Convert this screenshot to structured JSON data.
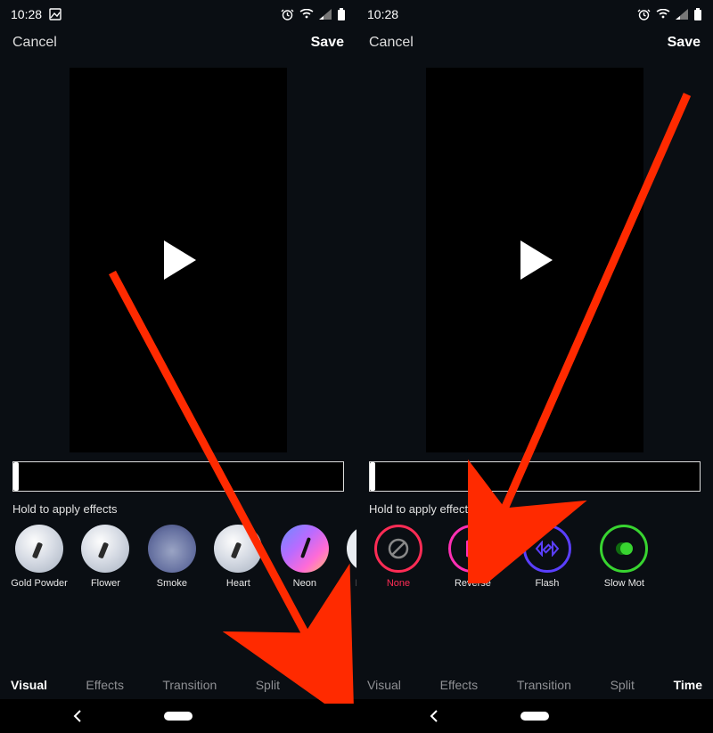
{
  "status": {
    "time": "10:28",
    "icons": [
      "picture",
      "alarm",
      "wifi",
      "signal",
      "battery"
    ]
  },
  "topbar": {
    "cancel": "Cancel",
    "save": "Save"
  },
  "hint": "Hold to apply effects",
  "visual_effects": [
    {
      "label": "Gold Powder"
    },
    {
      "label": "Flower"
    },
    {
      "label": "Smoke"
    },
    {
      "label": "Heart"
    },
    {
      "label": "Neon"
    },
    {
      "label": "Rainbo"
    }
  ],
  "time_effects": [
    {
      "label": "None",
      "color": "#fe2c55",
      "icon": "none"
    },
    {
      "label": "Reverse",
      "color": "#ff2fb3",
      "icon": "reverse"
    },
    {
      "label": "Flash",
      "color": "#5a3fff",
      "icon": "flash"
    },
    {
      "label": "Slow Mot",
      "color": "#38d430",
      "icon": "slowmo"
    }
  ],
  "tabs": [
    "Visual",
    "Effects",
    "Transition",
    "Split",
    "Time"
  ],
  "active_tab_left": "Visual",
  "active_tab_right": "Time",
  "arrows": {
    "color": "#ff2a00"
  }
}
